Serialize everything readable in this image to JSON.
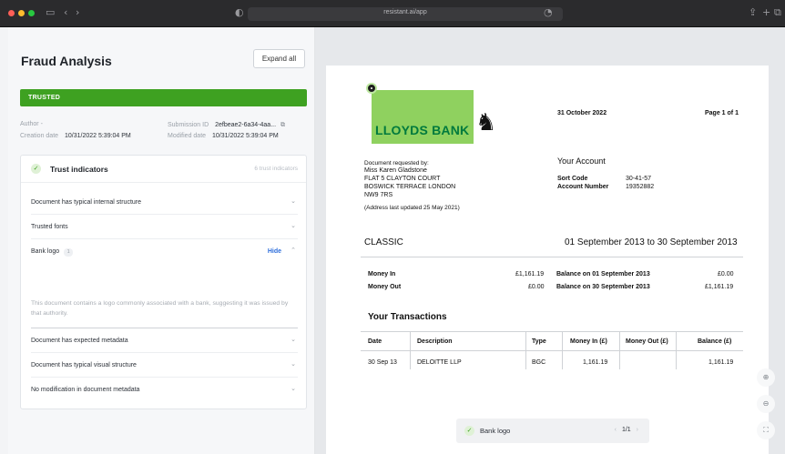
{
  "browser": {
    "url": "resistant.ai/app",
    "colors": {
      "close": "#ff5f57",
      "minimize": "#febc2e",
      "zoom": "#28c840"
    }
  },
  "panel": {
    "title": "Fraud Analysis",
    "expand_all": "Expand all",
    "status": "TRUSTED",
    "status_color": "#3ea121",
    "author_label": "Author",
    "author_value": "-",
    "creation_label": "Creation date",
    "creation_value": "10/31/2022 5:39:04 PM",
    "submission_label": "Submission ID",
    "submission_value": "2efbeae2-6a34-4aa...",
    "modified_label": "Modified date",
    "modified_value": "10/31/2022 5:39:04 PM",
    "card": {
      "title": "Trust indicators",
      "subtitle": "6 trust indicators",
      "items": [
        {
          "label": "Document has typical internal structure"
        },
        {
          "label": "Trusted fonts"
        },
        {
          "label": "Bank logo",
          "count": "1",
          "action": "Hide",
          "description": "This document contains a logo commonly associated with a bank, suggesting it was issued by that authority."
        },
        {
          "label": "Document has expected metadata"
        },
        {
          "label": "Document has typical visual structure"
        },
        {
          "label": "No modification in document metadata"
        }
      ]
    }
  },
  "doc": {
    "bank_name": "LLOYDS BANK",
    "date": "31 October 2022",
    "page": "Page 1 of 1",
    "requested_by": "Document requested by:",
    "name": "Miss Karen Gladstone",
    "address1": "FLAT 5 CLAYTON COURT",
    "address2": "BOSWICK TERRACE LONDON",
    "postcode": "NW9 7RS",
    "address_note": "(Address last updated 25 May 2021)",
    "your_account": "Your Account",
    "sort_code_label": "Sort Code",
    "sort_code": "30-41-57",
    "account_number_label": "Account Number",
    "account_number": "19352882",
    "account_type": "CLASSIC",
    "period": "01 September 2013 to 30 September 2013",
    "money_in_label": "Money In",
    "money_in": "£1,161.19",
    "money_out_label": "Money Out",
    "money_out": "£0.00",
    "bal_start_label": "Balance on 01 September 2013",
    "bal_start": "£0.00",
    "bal_end_label": "Balance on 30 September 2013",
    "bal_end": "£1,161.19",
    "transactions_title": "Your Transactions",
    "columns": [
      "Date",
      "Description",
      "Type",
      "Money In (£)",
      "Money Out (£)",
      "Balance (£)"
    ],
    "row": [
      "30 Sep 13",
      "DELOITTE LLP",
      "BGC",
      "1,161.19",
      "",
      "1,161.19"
    ]
  },
  "viewer": {
    "highlight_label": "Bank logo",
    "page_indicator": "1/1"
  }
}
